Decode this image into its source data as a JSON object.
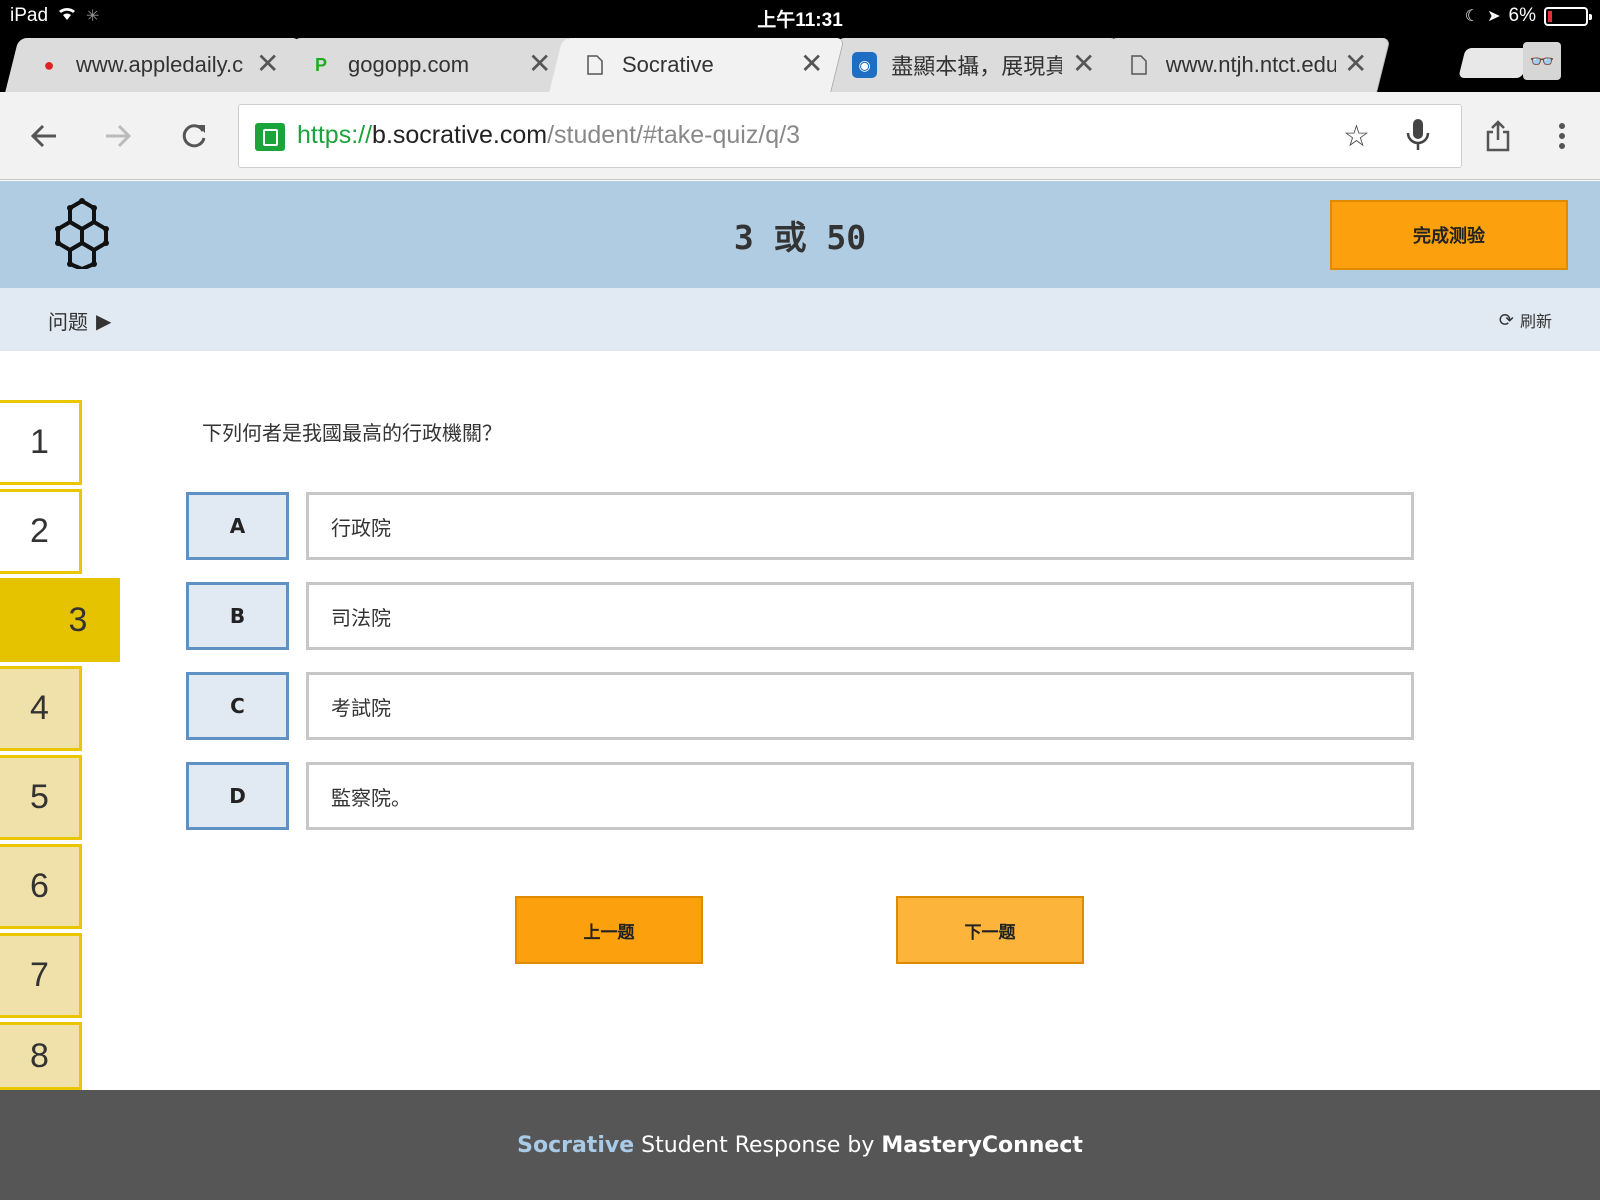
{
  "status_bar": {
    "device": "iPad",
    "time": "上午11:31",
    "battery": "6%"
  },
  "tabs": [
    {
      "title": "www.appledaily.c",
      "favicon": "apple-icon"
    },
    {
      "title": "gogopp.com",
      "favicon": "p-logo-icon"
    },
    {
      "title": "Socrative",
      "favicon": "page-icon"
    },
    {
      "title": "盡顯本攝，展現真",
      "favicon": "camera-app-icon"
    },
    {
      "title": "www.ntjh.ntct.edu",
      "favicon": "page-icon"
    }
  ],
  "omnibox": {
    "scheme": "https://",
    "host": "b.socrative.com",
    "path": "/student/#take-quiz/q/3"
  },
  "header": {
    "progress": "3 或 50",
    "finish_label": "完成测验"
  },
  "subheader": {
    "questions_label": "问题",
    "refresh_label": "刷新"
  },
  "question_nav": {
    "items": [
      "1",
      "2",
      "3",
      "4",
      "5",
      "6",
      "7",
      "8"
    ],
    "current": "3"
  },
  "question": {
    "text": "下列何者是我國最高的行政機關？",
    "choices": [
      {
        "letter": "A",
        "text": "行政院"
      },
      {
        "letter": "B",
        "text": "司法院"
      },
      {
        "letter": "C",
        "text": "考試院"
      },
      {
        "letter": "D",
        "text": "監察院。"
      }
    ]
  },
  "nav_buttons": {
    "prev": "上一题",
    "next": "下一题"
  },
  "footer": {
    "brand": "Socrative",
    "middle": " Student Response by ",
    "company": "MasteryConnect"
  },
  "colors": {
    "accent_orange": "#fca10d",
    "header_blue": "#afcce3",
    "nav_yellow": "#e6c300",
    "footer_gray": "#565656"
  }
}
